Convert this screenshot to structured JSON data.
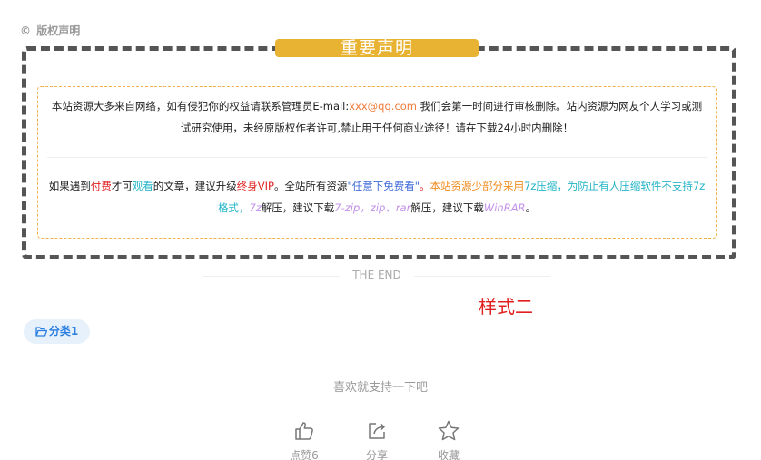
{
  "copyright": {
    "icon_text": "©",
    "label": "版权声明"
  },
  "notice": {
    "title": "重要声明",
    "para1": {
      "prefix": "本站资源大多来自网络，如有侵犯你的权益请联系管理员E-mail:",
      "email": "xxx@qq.com",
      "suffix": " 我们会第一时间进行审核删除。站内资源为网友个人学习或测试研究使用，未经原版权作者许可,禁止用于任何商业途径！请在下载24小时内删除！"
    },
    "para2": {
      "t1": "如果遇到",
      "paid": "付费",
      "t2": "才可",
      "view": "观看",
      "t3": "的文章，建议升级",
      "vip": "终身VIP",
      "t4": "。全站所有资源",
      "free": "\"任意下免费看\"",
      "t5": "。",
      "orange": "本站资源少部分采用",
      "zip7": "7z压缩",
      "teal2": "，为防止有人压缩软件不支持7z格式，",
      "p7z": "7z",
      "t6": "解压，建议下载",
      "pzip": "7-zip",
      "sep": "，",
      "pzip2": "zip、rar",
      "t7": "解压，建议下载",
      "winrar": "WinRAR",
      "t8": "。"
    }
  },
  "the_end": "THE END",
  "style_label": "样式二",
  "category": {
    "icon": "folder-open-icon",
    "label": "分类1"
  },
  "support_text": "喜欢就支持一下吧",
  "actions": {
    "like": {
      "icon": "thumbs-up-icon",
      "label": "点赞6"
    },
    "share": {
      "icon": "share-icon",
      "label": "分享"
    },
    "favorite": {
      "icon": "star-icon",
      "label": "收藏"
    }
  },
  "colors": {
    "title_bg": "#e8b232",
    "frame": "#555555",
    "red": "#e02020",
    "teal": "#25b5c7",
    "blue": "#3f6ad8",
    "orange": "#f08a1c",
    "purple": "#c28fe8",
    "tag_bg": "#e6f1fc",
    "tag_fg": "#2a7fe0"
  }
}
